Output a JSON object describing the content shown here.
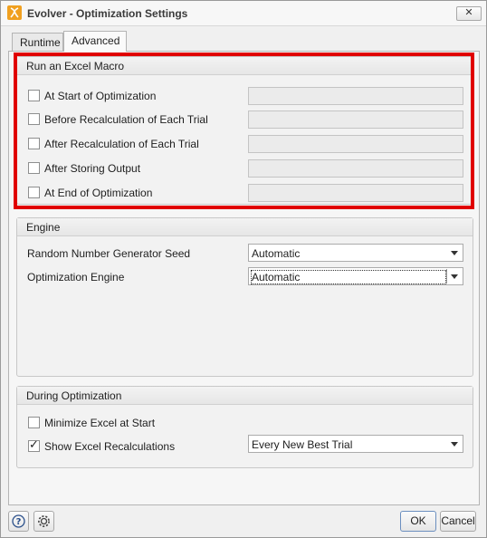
{
  "window": {
    "title": "Evolver - Optimization Settings",
    "close_glyph": "✕"
  },
  "tabs": [
    {
      "label": "Runtime",
      "active": false
    },
    {
      "label": "Advanced",
      "active": true
    }
  ],
  "macro_group": {
    "title": "Run an Excel Macro",
    "items": [
      {
        "label": "At Start of Optimization",
        "checked": false,
        "value": ""
      },
      {
        "label": "Before Recalculation of Each Trial",
        "checked": false,
        "value": ""
      },
      {
        "label": "After Recalculation of Each Trial",
        "checked": false,
        "value": ""
      },
      {
        "label": "After Storing Output",
        "checked": false,
        "value": ""
      },
      {
        "label": "At End of Optimization",
        "checked": false,
        "value": ""
      }
    ]
  },
  "engine_group": {
    "title": "Engine",
    "seed_label": "Random Number Generator Seed",
    "seed_value": "Automatic",
    "engine_label": "Optimization Engine",
    "engine_value": "Automatic"
  },
  "during_group": {
    "title": "During Optimization",
    "minimize_label": "Minimize Excel at Start",
    "minimize_checked": false,
    "recalc_label": "Show Excel Recalculations",
    "recalc_checked": true,
    "recalc_value": "Every New Best Trial"
  },
  "footer": {
    "help_icon": "help-icon",
    "settings_icon": "gear-icon",
    "ok_label": "OK",
    "cancel_label": "Cancel"
  },
  "colors": {
    "highlight": "#e00000",
    "app_icon": "#f0a020"
  }
}
